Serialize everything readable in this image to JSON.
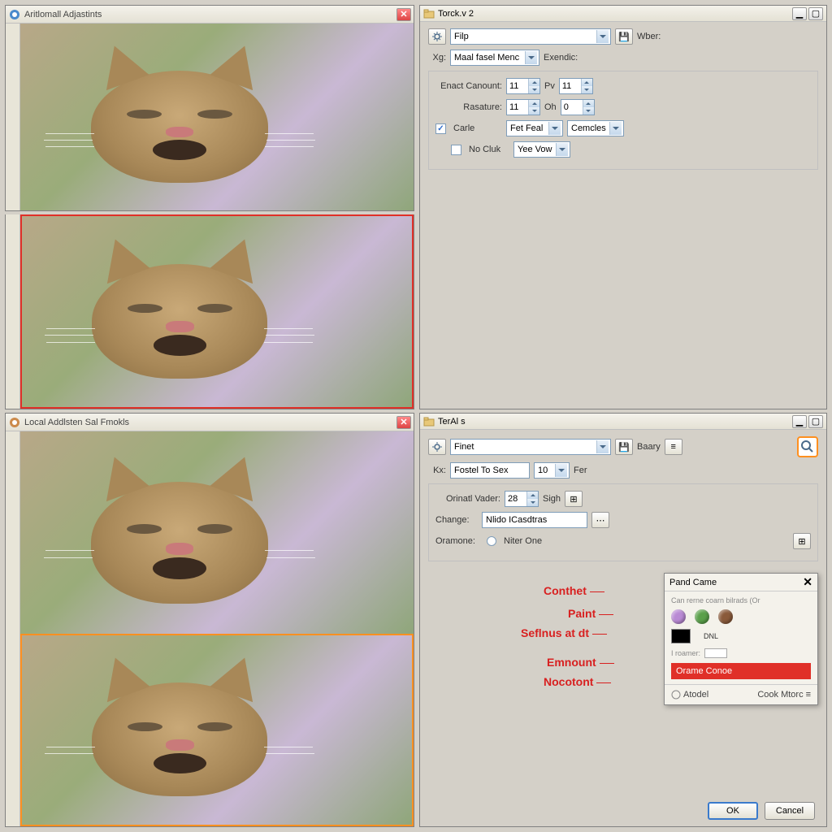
{
  "windows": {
    "topLeft": {
      "title": "Aritlomall Adjastints"
    },
    "bottomLeft": {
      "title": "Local Addlsten Sal Fmokls"
    }
  },
  "panel1": {
    "title": "Torck.v 2",
    "preset_label": "Filp",
    "wber": "Wber:",
    "xg": "Xg:",
    "xg_value": "Maal fasel Menc",
    "exendic": "Exendic:",
    "enact_label": "Enact Canount:",
    "enact_value": "11",
    "px": "Pv",
    "px_value": "11",
    "rasature_label": "Rasature:",
    "rasature_value": "11",
    "oh": "Oh",
    "oh_value": "0",
    "carle": "Carle",
    "carle_value": "Fet Feal",
    "cemcles": "Cemcles",
    "nocluk": "No Cluk",
    "yevow": "Yee Vow"
  },
  "panel2": {
    "title": "TerAl s",
    "preset_label": "Finet",
    "baary": "Baary",
    "kx": "Kx:",
    "kx_value": "Fostel To Sex",
    "kx_num": "10",
    "fer": "Fer",
    "orinatl_label": "Orinatl Vader:",
    "orinatl_value": "28",
    "sigh": "Sigh",
    "change_label": "Change:",
    "change_value": "Nlido ICasdtras",
    "oramone_label": "Oramone:",
    "oramone_opt": "Niter One"
  },
  "annotations": {
    "a1": "Conthet",
    "a2": "Paint",
    "a3": "Seflnus at dt",
    "a4": "Emnount",
    "a5": "Nocotont"
  },
  "popup": {
    "title": "Pand Came",
    "subtitle": "Can rerne coarn bilrads (Or",
    "dnl": "DNL",
    "roamer": "I roamer:",
    "redbtn": "Orame Conoe",
    "about": "Atodel",
    "more": "Cook Mtorc"
  },
  "buttons": {
    "ok": "OK",
    "cancel": "Cancel"
  },
  "colors": {
    "purple": "#b98ad4",
    "green": "#5aa04a",
    "brown": "#8a5a3a"
  }
}
